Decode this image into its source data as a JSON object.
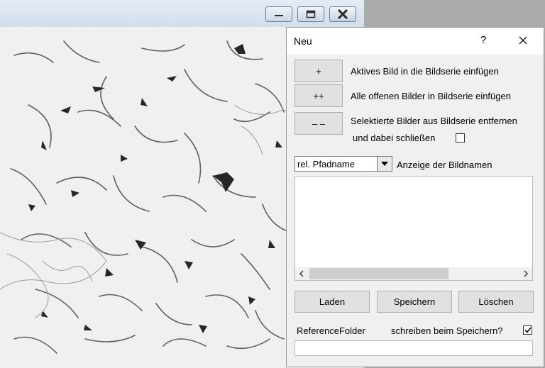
{
  "background_window": {
    "caption_buttons": {
      "minimize_icon": "minimize-icon",
      "maximize_icon": "maximize-icon",
      "close_icon": "close-icon"
    },
    "image_content": "micrograph"
  },
  "dialog": {
    "title": "Neu",
    "help": "?",
    "actions": [
      {
        "button": "+",
        "description": "Aktives Bild in die Bildserie einfügen"
      },
      {
        "button": "++",
        "description": "Alle offenen Bilder in Bildserie einfügen"
      },
      {
        "button": "– –",
        "description": "Selektierte Bilder aus Bildserie entfernen"
      }
    ],
    "close_option": {
      "label": "und dabei schließen",
      "checked": false
    },
    "display_select": {
      "value": "rel. Pfadname",
      "label": "Anzeige der Bildnamen"
    },
    "image_list": [],
    "buttons": {
      "load": "Laden",
      "save": "Speichern",
      "delete": "Löschen"
    },
    "reference_folder": {
      "label": "ReferenceFolder",
      "write_label": "schreiben beim Speichern?",
      "write_checked": true,
      "value": ""
    }
  },
  "colors": {
    "dialog_bg": "#f0f0f0",
    "button_bg": "#e1e1e1",
    "backdrop": "#ababab"
  }
}
